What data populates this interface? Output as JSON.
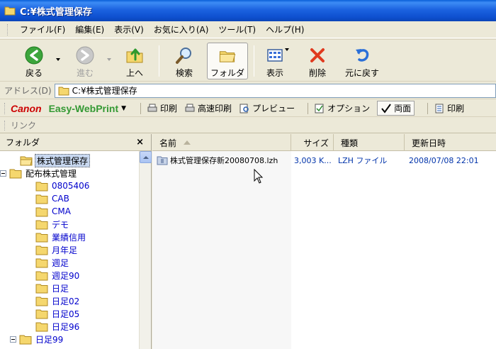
{
  "window": {
    "title": "C:¥株式管理保存"
  },
  "menu": [
    "ファイル(F)",
    "編集(E)",
    "表示(V)",
    "お気に入り(A)",
    "ツール(T)",
    "ヘルプ(H)"
  ],
  "toolbar": {
    "back": "戻る",
    "forward": "進む",
    "up": "上へ",
    "search": "検索",
    "folders": "フォルダ",
    "view": "表示",
    "delete": "削除",
    "undo": "元に戻す"
  },
  "address": {
    "label": "アドレス(D)",
    "value": "C:¥株式管理保存"
  },
  "canonbar": {
    "logo": "Canon",
    "product": "Easy-WebPrint",
    "items": [
      "印刷",
      "高速印刷",
      "プレビュー",
      "オプション",
      "両面",
      "印刷"
    ]
  },
  "links": {
    "label": "リンク"
  },
  "folderpane": {
    "title": "フォルダ",
    "close": "×",
    "items": [
      {
        "label": "株式管理保存",
        "level": 1,
        "selected": true,
        "expander": false
      },
      {
        "label": "配布株式管理",
        "level": 0,
        "selected": false,
        "expander": true
      },
      {
        "label": "0805406",
        "level": 2,
        "selected": false,
        "expander": false
      },
      {
        "label": "CAB",
        "level": 2,
        "selected": false,
        "expander": false
      },
      {
        "label": "CMA",
        "level": 2,
        "selected": false,
        "expander": false
      },
      {
        "label": "デモ",
        "level": 2,
        "selected": false,
        "expander": false
      },
      {
        "label": "業績信用",
        "level": 2,
        "selected": false,
        "expander": false
      },
      {
        "label": "月年足",
        "level": 2,
        "selected": false,
        "expander": false
      },
      {
        "label": "週足",
        "level": 2,
        "selected": false,
        "expander": false
      },
      {
        "label": "週足90",
        "level": 2,
        "selected": false,
        "expander": false
      },
      {
        "label": "日足",
        "level": 2,
        "selected": false,
        "expander": false
      },
      {
        "label": "日足02",
        "level": 2,
        "selected": false,
        "expander": false
      },
      {
        "label": "日足05",
        "level": 2,
        "selected": false,
        "expander": false
      },
      {
        "label": "日足96",
        "level": 2,
        "selected": false,
        "expander": false
      },
      {
        "label": "日足99",
        "level": 1,
        "selected": false,
        "expander": true
      }
    ]
  },
  "filelist": {
    "columns": {
      "name": "名前",
      "size": "サイズ",
      "type": "種類",
      "modified": "更新日時"
    },
    "rows": [
      {
        "name": "株式管理保存新20080708.lzh",
        "size": "3,003 K...",
        "type": "LZH ファイル",
        "modified": "2008/07/08 22:01"
      }
    ]
  }
}
